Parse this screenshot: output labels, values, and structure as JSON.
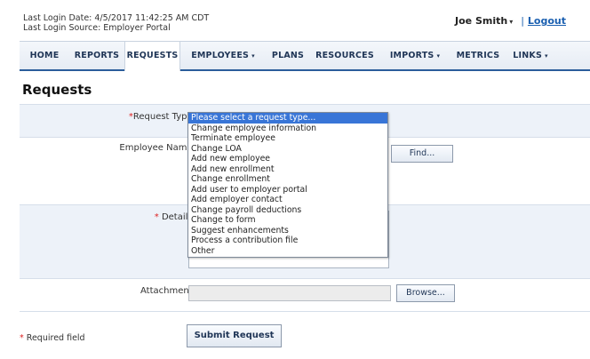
{
  "header": {
    "last_login_date": "Last Login Date: 4/5/2017 11:42:25 AM CDT",
    "last_login_source": "Last Login Source: Employer Portal",
    "user_name": "Joe Smith",
    "user_caret": "▾",
    "separator": "|",
    "logout": "Logout"
  },
  "nav": {
    "items": [
      {
        "label": "HOME",
        "caret": ""
      },
      {
        "label": "REPORTS",
        "caret": ""
      },
      {
        "label": "REQUESTS",
        "caret": ""
      },
      {
        "label": "EMPLOYEES",
        "caret": "▾"
      },
      {
        "label": "PLANS",
        "caret": ""
      },
      {
        "label": "RESOURCES",
        "caret": ""
      },
      {
        "label": "IMPORTS",
        "caret": "▾"
      },
      {
        "label": "METRICS",
        "caret": ""
      },
      {
        "label": "LINKS",
        "caret": "▾"
      }
    ],
    "active": "REQUESTS"
  },
  "page": {
    "title": "Requests"
  },
  "form": {
    "request_type": {
      "required_mark": "*",
      "label": "Request Type:",
      "selected": "Please select a request type...",
      "options": [
        "Please select a request type...",
        "Change employee information",
        "Terminate employee",
        "Change LOA",
        "Add new employee",
        "Add new enrollment",
        "Change enrollment",
        "Add user to employer portal",
        "Add employer contact",
        "Change payroll deductions",
        "Change to form",
        "Suggest enhancements",
        "Process a contribution file",
        "Other"
      ]
    },
    "employee_name": {
      "label": "Employee Name:",
      "find_button": "Find..."
    },
    "details": {
      "required_mark": "*",
      "label": "Details:"
    },
    "attachment": {
      "label": "Attachment:",
      "browse_button": "Browse..."
    },
    "submit_button": "Submit Request",
    "required_note": {
      "mark": "*",
      "text": "Required field"
    }
  }
}
